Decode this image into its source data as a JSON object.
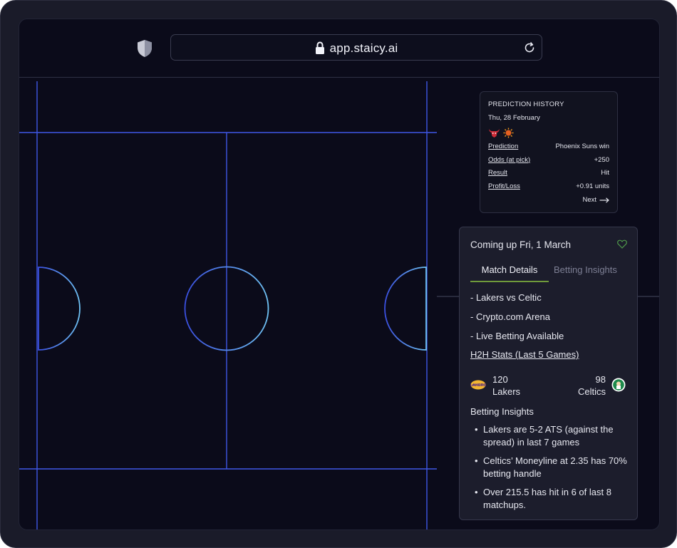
{
  "browser": {
    "url": "app.staicy.ai"
  },
  "history": {
    "title": "PREDICTION HISTORY",
    "date": "Thu, 28 February",
    "rows": [
      {
        "label": "Prediction",
        "value": "Phoenix Suns win"
      },
      {
        "label": "Odds (at pick)",
        "value": "+250"
      },
      {
        "label": "Result",
        "value": "Hit"
      },
      {
        "label": "Profit/Loss",
        "value": "+0.91 units"
      }
    ],
    "next_label": "Next"
  },
  "match": {
    "title": "Coming up Fri, 1 March",
    "tabs": [
      "Match Details",
      "Betting Insights"
    ],
    "details": [
      "- Lakers vs Celtic",
      "- Crypto.com Arena",
      "- Live Betting Available"
    ],
    "h2h_label": "H2H Stats (Last 5 Games)",
    "home": {
      "score": "120",
      "name": "Lakers"
    },
    "away": {
      "score": "98",
      "name": "Celtics"
    },
    "insights_title": "Betting Insights",
    "insights": [
      "Lakers are 5-2 ATS (against the spread) in last 7 games",
      "Celtics’ Moneyline at 2.35 has 70% betting handle",
      "Over 215.5 has hit in 6 of last 8 matchups."
    ]
  },
  "colors": {
    "court_line": "#3f57e6",
    "circle_gradient_start": "#3a4fe0",
    "circle_gradient_end": "#6fc2f4",
    "tab_accent": "#6f9a3b",
    "heart": "#4f9a4a"
  },
  "icons": {
    "shield": "shield-icon",
    "lock": "lock-icon",
    "reload": "reload-icon",
    "heart": "heart-icon",
    "bulls": "bulls-logo-icon",
    "suns": "suns-logo-icon",
    "lakers": "lakers-logo-icon",
    "celtics": "celtics-logo-icon",
    "arrow": "arrow-right-icon"
  }
}
